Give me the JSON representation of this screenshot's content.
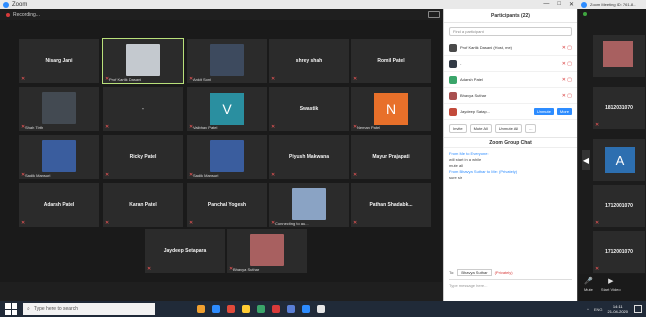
{
  "window": {
    "title": "Zoom",
    "controls": [
      "—",
      "□",
      "✕"
    ]
  },
  "recording": {
    "label": "Recording..."
  },
  "gallery": {
    "tiles": [
      {
        "name": "Nisarg Jani",
        "label": "",
        "kind": "name"
      },
      {
        "name": "",
        "label": "Prof Kartik Dasani",
        "kind": "video",
        "color": "#c4c9cf"
      },
      {
        "name": "",
        "label": "Ankit Soni",
        "kind": "video",
        "color": "#3d4a5e"
      },
      {
        "name": "shrey shah",
        "label": "",
        "kind": "name"
      },
      {
        "name": "Romil Patel",
        "label": "",
        "kind": "name"
      },
      {
        "name": "",
        "label": "Shah Tirth",
        "kind": "video",
        "color": "#434a52"
      },
      {
        "name": "-",
        "label": "",
        "kind": "name"
      },
      {
        "name": "",
        "label": "Vaibhav Patel",
        "kind": "avatar",
        "letter": "V",
        "color": "#2a8fa0"
      },
      {
        "name": "Swastik",
        "label": "",
        "kind": "name"
      },
      {
        "name": "",
        "label": "Neman Patel",
        "kind": "avatar",
        "letter": "N",
        "color": "#e8702a"
      },
      {
        "name": "",
        "label": "Sadik Mansuri",
        "kind": "video",
        "color": "#3a5d9e"
      },
      {
        "name": "Ricky Patel",
        "label": "",
        "kind": "name"
      },
      {
        "name": "",
        "label": "Sadik Mansuri",
        "kind": "video",
        "color": "#3a5d9e"
      },
      {
        "name": "Piyush Makwana",
        "label": "",
        "kind": "name"
      },
      {
        "name": "Mayur Prajapati",
        "label": "",
        "kind": "name"
      },
      {
        "name": "Adarsh Patel",
        "label": "",
        "kind": "name"
      },
      {
        "name": "Karan Patel",
        "label": "",
        "kind": "name"
      },
      {
        "name": "Panchal Yogesh",
        "label": "",
        "kind": "name"
      },
      {
        "name": "",
        "label": "Connecting to au...",
        "kind": "video",
        "color": "#8aa3c4"
      },
      {
        "name": "Pathan Shadabk...",
        "label": "",
        "kind": "name"
      },
      {
        "name": "Jaydeep Setapara",
        "label": "",
        "kind": "name"
      },
      {
        "name": "",
        "label": "Bhavya Suthar",
        "kind": "video",
        "color": "#a86060"
      }
    ]
  },
  "participants": {
    "title": "Participants (22)",
    "search_placeholder": "Find a participant",
    "rows": [
      {
        "name": "Prof Kartik Dasani (Host, me)",
        "color": "#4a4a4a",
        "action": ""
      },
      {
        "name": "-",
        "color": "#333b46",
        "action": ""
      },
      {
        "name": "Adarsh Patel",
        "color": "#3aa56a",
        "action": ""
      },
      {
        "name": "Bhavya Suthar",
        "color": "#a85050",
        "action": ""
      },
      {
        "name": "Jaydeep Satap...",
        "color": "#c24a3a",
        "action": "Unmute",
        "more": "More"
      }
    ],
    "buttons": [
      "Invite",
      "Mute All",
      "Unmute All",
      "..."
    ]
  },
  "chat": {
    "title": "Zoom Group Chat",
    "messages": [
      {
        "from": "From Me to Everyone:",
        "text": "will start in a while"
      },
      {
        "from": "",
        "text": "mute all"
      },
      {
        "from": "From Bhavya Suthar to Me: (Privately)",
        "text": "sure sir"
      }
    ],
    "to_label": "To:",
    "to_value": "Bhavya Suthar",
    "privately": "(Privately)",
    "type_placeholder": "Type message here..."
  },
  "side_window": {
    "title": "Zoom Meeting ID: 761-8...",
    "tiles": [
      "",
      "1812031070",
      "A",
      "1712001070",
      "1712001070"
    ],
    "mute_label": "Mute",
    "video_label": "Start Video"
  },
  "taskbar": {
    "search_placeholder": "Type here to search",
    "clock_time": "14:11",
    "clock_date": "21-04-2020",
    "lang": "ENG",
    "app_colors": [
      "#f0a030",
      "#2d8cff",
      "#e04a3a",
      "#ffcc33",
      "#3aa56a",
      "#d83a3a",
      "#5a7fd6",
      "#2d8cff",
      "#e6e6e6"
    ]
  }
}
